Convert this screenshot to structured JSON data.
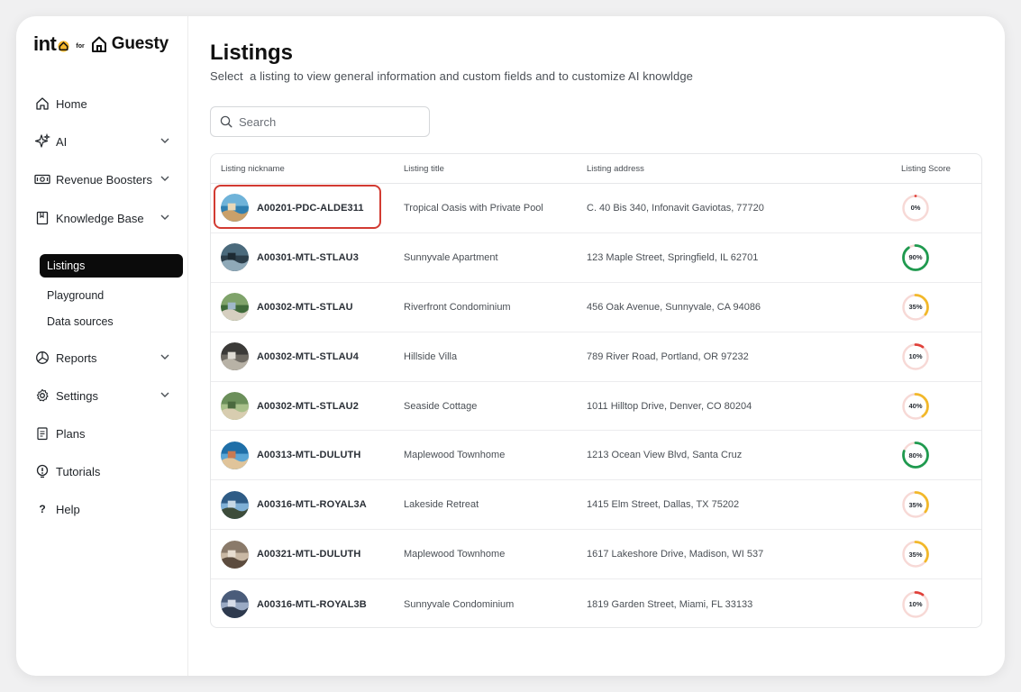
{
  "brand": {
    "into": "int",
    "for": "for",
    "guesty": "Guesty"
  },
  "sidebar": {
    "items": [
      {
        "label": "Home",
        "icon": "home-icon",
        "expandable": false
      },
      {
        "label": "AI",
        "icon": "sparkles-icon",
        "expandable": true
      },
      {
        "label": "Revenue Boosters",
        "icon": "cash-icon",
        "expandable": true
      },
      {
        "label": "Knowledge Base",
        "icon": "book-icon",
        "expandable": true
      },
      {
        "label": "Reports",
        "icon": "pie-chart-icon",
        "expandable": true
      },
      {
        "label": "Settings",
        "icon": "gear-icon",
        "expandable": true
      },
      {
        "label": "Plans",
        "icon": "clipboard-icon",
        "expandable": false
      },
      {
        "label": "Tutorials",
        "icon": "lightbulb-icon",
        "expandable": false
      },
      {
        "label": "Help",
        "icon": "question-icon",
        "expandable": false
      }
    ],
    "knowledge_base_sub": [
      {
        "label": "Listings",
        "active": true
      },
      {
        "label": "Playground",
        "active": false
      },
      {
        "label": "Data sources",
        "active": false
      }
    ]
  },
  "main": {
    "title": "Listings",
    "subtitle": "Select  a listing to view general information and custom fields and to customize AI knowldge",
    "search": {
      "placeholder": "Search",
      "value": ""
    }
  },
  "table": {
    "columns": [
      "Listing nickname",
      "Listing title",
      "Listing address",
      "Listing Score"
    ],
    "rows": [
      {
        "nickname": "A00201-PDC-ALDE311",
        "title": "Tropical Oasis with Private Pool",
        "address": "C. 40 Bis 340, Infonavit Gaviotas, 77720",
        "score": 0,
        "score_label": "0%",
        "highlighted": true
      },
      {
        "nickname": "A00301-MTL-STLAU3",
        "title": "Sunnyvale Apartment",
        "address": "123 Maple Street, Springfield, IL 62701",
        "score": 90,
        "score_label": "90%",
        "highlighted": false
      },
      {
        "nickname": "A00302-MTL-STLAU",
        "title": "Riverfront Condominium",
        "address": "456 Oak Avenue, Sunnyvale, CA 94086",
        "score": 35,
        "score_label": "35%",
        "highlighted": false
      },
      {
        "nickname": "A00302-MTL-STLAU4",
        "title": "Hillside Villa",
        "address": "789 River Road, Portland, OR 97232",
        "score": 10,
        "score_label": "10%",
        "highlighted": false
      },
      {
        "nickname": "A00302-MTL-STLAU2",
        "title": "Seaside Cottage",
        "address": "1011 Hilltop Drive, Denver, CO 80204",
        "score": 40,
        "score_label": "40%",
        "highlighted": false
      },
      {
        "nickname": "A00313-MTL-DULUTH",
        "title": "Maplewood Townhome",
        "address": "1213 Ocean View Blvd, Santa Cruz",
        "score": 80,
        "score_label": "80%",
        "highlighted": false
      },
      {
        "nickname": "A00316-MTL-ROYAL3A",
        "title": "Lakeside Retreat",
        "address": "1415 Elm Street, Dallas, TX 75202",
        "score": 35,
        "score_label": "35%",
        "highlighted": false
      },
      {
        "nickname": "A00321-MTL-DULUTH",
        "title": "Maplewood Townhome",
        "address": "1617 Lakeshore Drive, Madison, WI 537",
        "score": 35,
        "score_label": "35%",
        "highlighted": false
      },
      {
        "nickname": "A00316-MTL-ROYAL3B",
        "title": "Sunnyvale Condominium",
        "address": "1819 Garden Street, Miami, FL 33133",
        "score": 10,
        "score_label": "10%",
        "highlighted": false
      }
    ]
  },
  "colors": {
    "accent_dark": "#0b0b0b",
    "highlight_border": "#d23b32",
    "score_high": "#1f9a4f",
    "score_mid": "#f2b82a",
    "score_low": "#e0413a",
    "score_track": "#f7d9d6",
    "brand_yellow": "#f5b82e"
  }
}
